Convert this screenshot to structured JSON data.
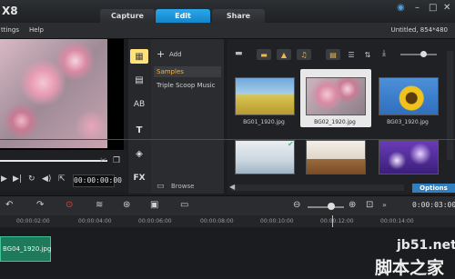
{
  "app": {
    "title": "X8",
    "project_info": "Untitled, 854*480"
  },
  "tabs": [
    "Capture",
    "Edit",
    "Share"
  ],
  "menu": [
    "ttings",
    "Help"
  ],
  "library": {
    "add_label": "Add",
    "folders": [
      "Samples",
      "Triple Scoop Music"
    ],
    "browse_label": "Browse",
    "options_label": "Options",
    "thumbnails": [
      {
        "label": "BG01_1920.jpg",
        "icon": "field-image"
      },
      {
        "label": "BG02_1920.jpg",
        "icon": "blossom-image"
      },
      {
        "label": "BG03_1920.jpg",
        "icon": "sunflower-image"
      },
      {
        "label": "",
        "icon": "room-image"
      },
      {
        "label": "",
        "icon": "sofa-image"
      },
      {
        "label": "",
        "icon": "purple-lights-image"
      }
    ]
  },
  "preview": {
    "timecode": "00:00:00:00"
  },
  "timeline": {
    "time": "0:00:03:00",
    "ruler": [
      "00:00:02:00",
      "00:00:04:00",
      "00:00:06:00",
      "00:00:08:00",
      "00:00:10:00",
      "00:00:12:00",
      "00:00:14:00"
    ],
    "clip_label": "BG04_1920.jpg"
  },
  "watermark": {
    "line1": "jb51.net",
    "line2": "脚本之家"
  },
  "colors": {
    "accent": "#1f8fd8",
    "selection": "#ffe27a",
    "clip": "#1f7a5b",
    "marker": "#c7171b"
  }
}
